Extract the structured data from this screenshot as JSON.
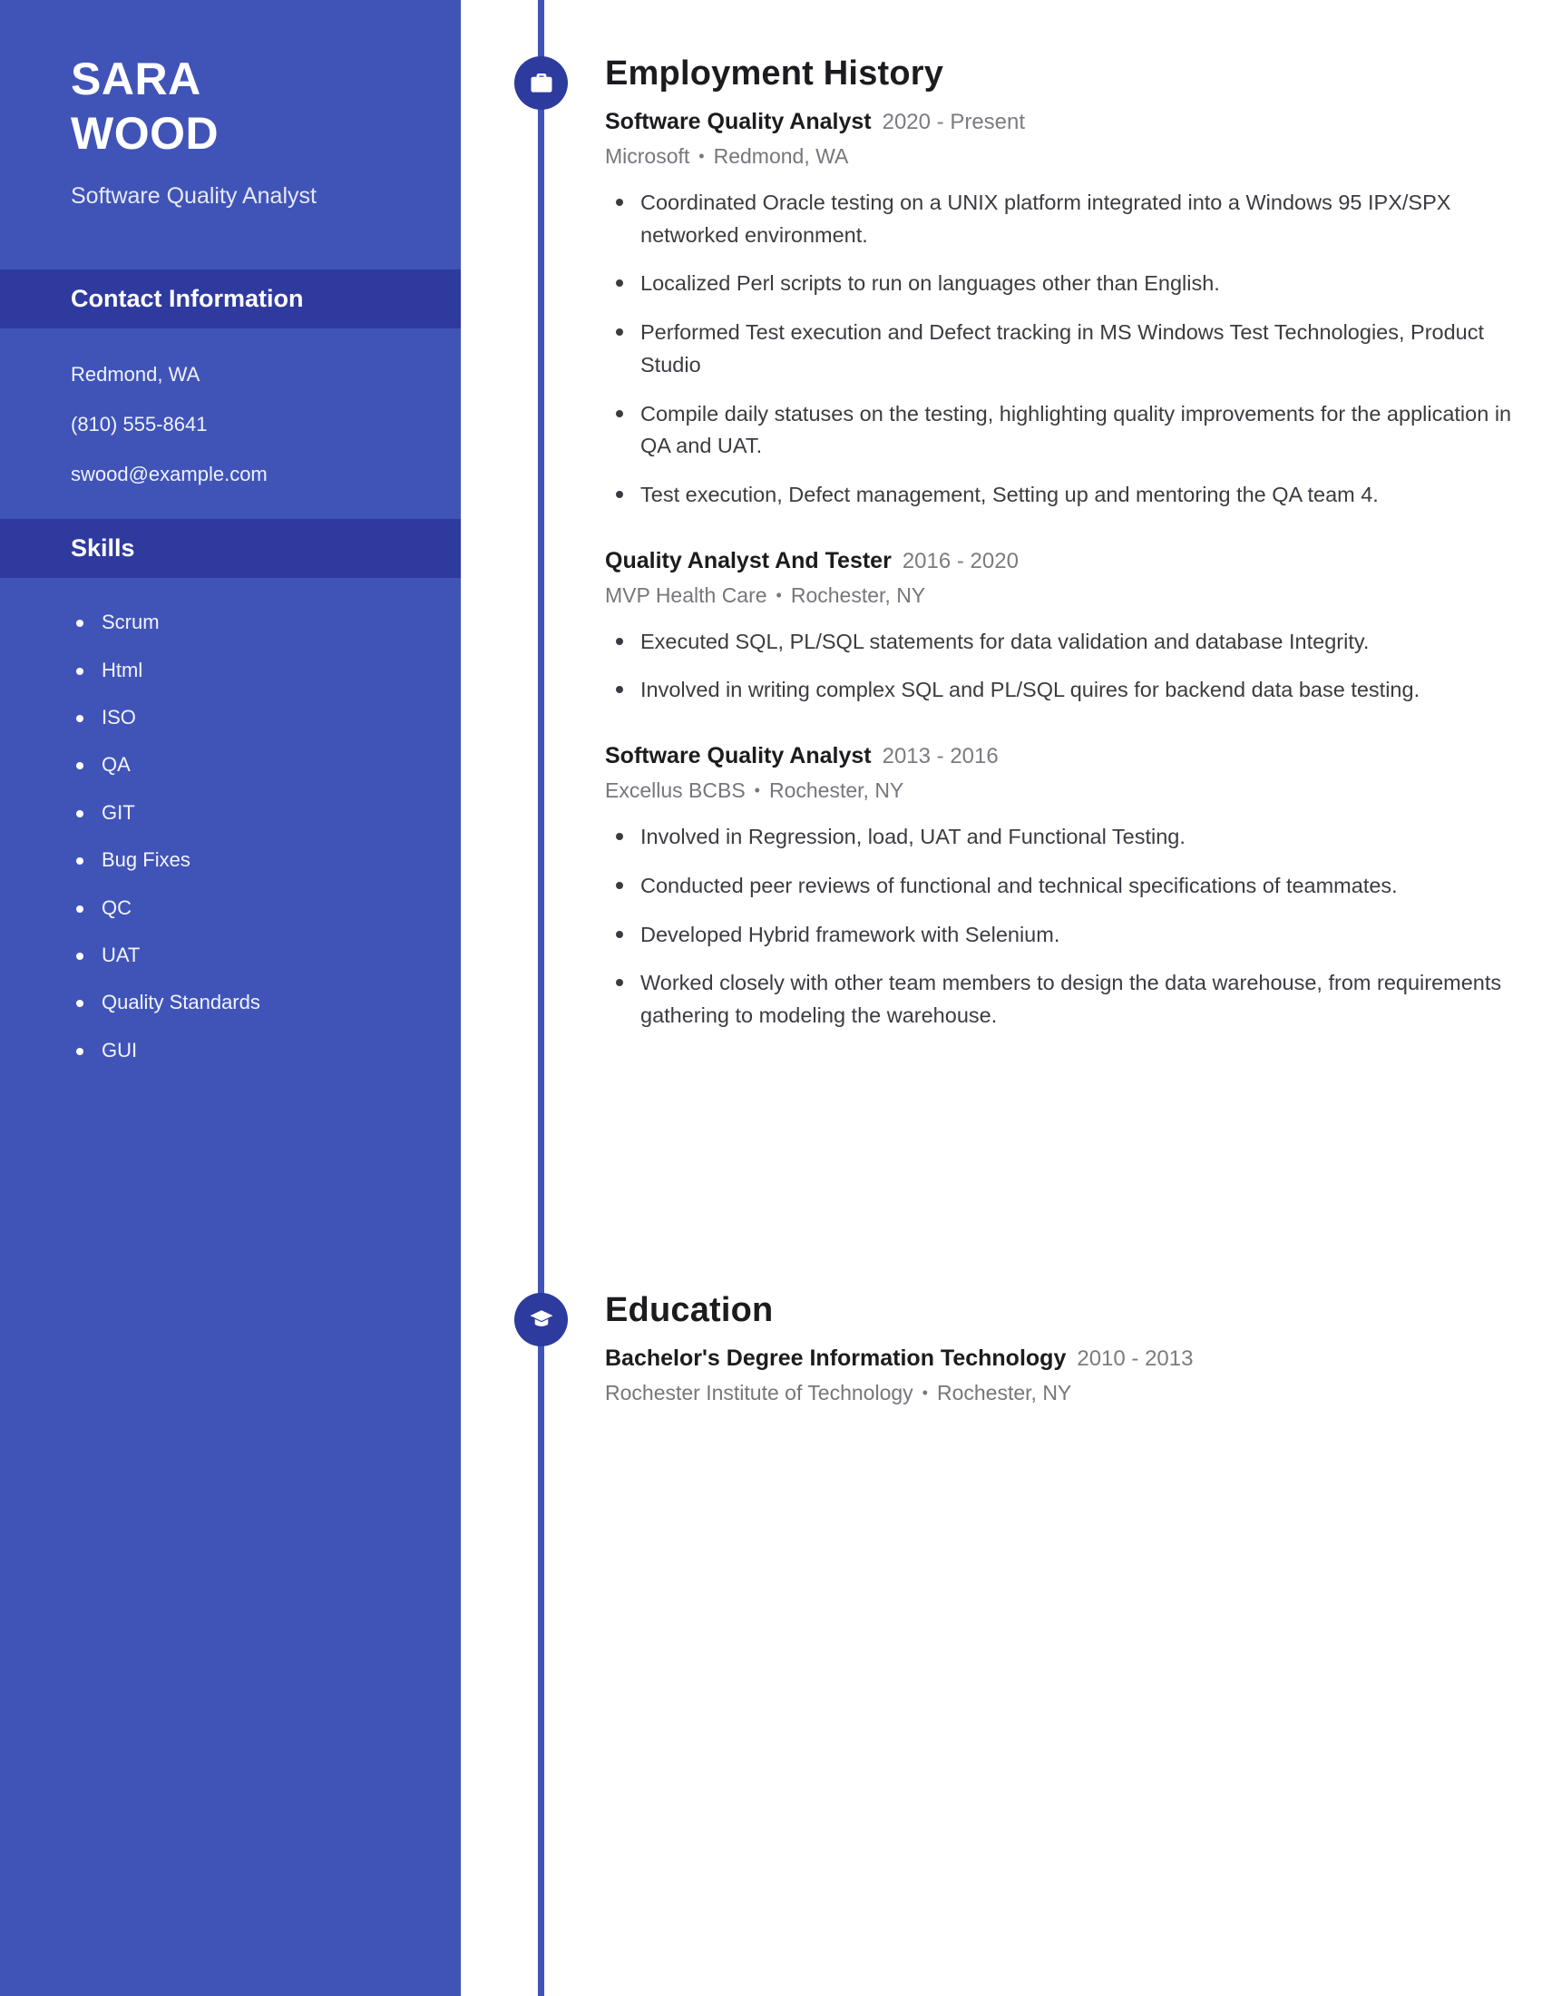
{
  "theme": {
    "sidebar_bg": "#4054b8",
    "sidebar_header_bg": "#2f3a9e",
    "accent": "#2d3a9e",
    "rail": "#4054b8",
    "text_dark": "#1c1c20",
    "text_muted": "#76767e"
  },
  "sidebar": {
    "name_first": "SARA",
    "name_last": "WOOD",
    "headline": "Software Quality Analyst",
    "contact": {
      "heading": "Contact Information",
      "location": "Redmond, WA",
      "phone": "(810) 555-8641",
      "email": "swood@example.com"
    },
    "skills": {
      "heading": "Skills",
      "items": [
        "Scrum",
        "Html",
        "ISO",
        "QA",
        "GIT",
        "Bug Fixes",
        "QC",
        "UAT",
        "Quality Standards",
        "GUI"
      ]
    }
  },
  "employment": {
    "heading": "Employment History",
    "icon": "briefcase-icon",
    "jobs": [
      {
        "role": "Software Quality Analyst",
        "dates": "2020 - Present",
        "company": "Microsoft",
        "location": "Redmond, WA",
        "bullets": [
          "Coordinated Oracle testing on a UNIX platform integrated into a Windows 95 IPX/SPX networked environment.",
          "Localized Perl scripts to run on languages other than English.",
          "Performed Test execution and Defect tracking in MS Windows Test Technologies, Product Studio",
          "Compile daily statuses on the testing, highlighting quality improvements for the application in QA and UAT.",
          "Test execution, Defect management, Setting up and mentoring the QA team 4."
        ]
      },
      {
        "role": "Quality Analyst And Tester",
        "dates": "2016 - 2020",
        "company": "MVP Health Care",
        "location": "Rochester, NY",
        "bullets": [
          "Executed SQL, PL/SQL statements for data validation and database Integrity.",
          "Involved in writing complex SQL and PL/SQL quires for backend data base testing."
        ]
      },
      {
        "role": "Software Quality Analyst",
        "dates": "2013 - 2016",
        "company": "Excellus BCBS",
        "location": "Rochester, NY",
        "bullets": [
          "Involved in Regression, load, UAT and Functional Testing.",
          "Conducted peer reviews of functional and technical specifications of teammates.",
          "Developed Hybrid framework with Selenium.",
          "Worked closely with other team members to design the data warehouse, from requirements gathering to modeling the warehouse."
        ]
      }
    ]
  },
  "education": {
    "heading": "Education",
    "icon": "graduation-cap-icon",
    "entries": [
      {
        "degree": "Bachelor's Degree Information Technology",
        "dates": "2010 - 2013",
        "school": "Rochester Institute of Technology",
        "location": "Rochester, NY"
      }
    ]
  },
  "separator": "•"
}
